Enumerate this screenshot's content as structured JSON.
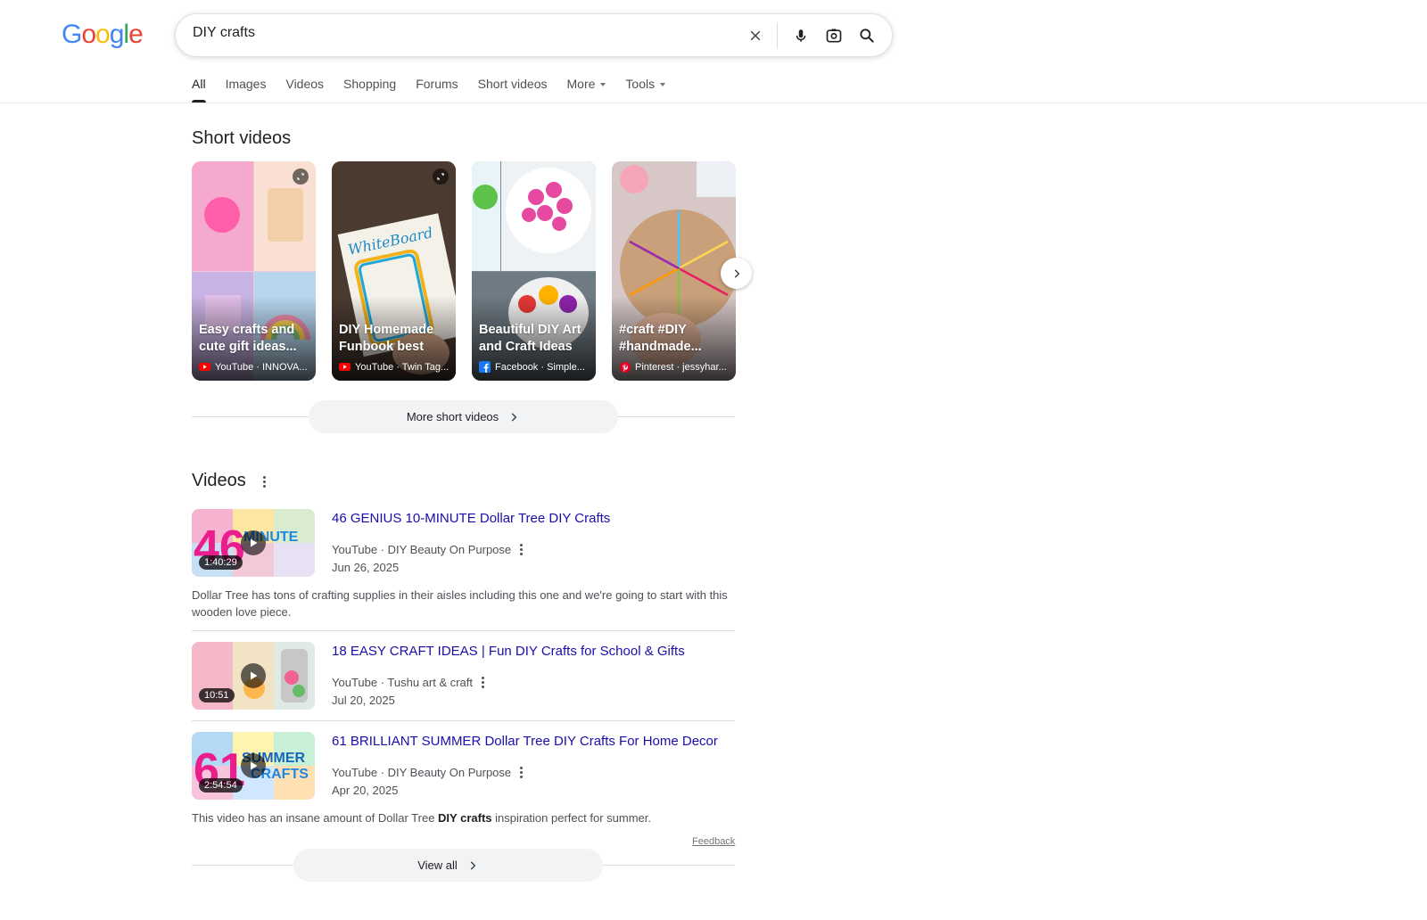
{
  "logo": {
    "letters": [
      "G",
      "o",
      "o",
      "g",
      "l",
      "e"
    ],
    "colors": [
      "#4285F4",
      "#EA4335",
      "#FBBC05",
      "#4285F4",
      "#34A853",
      "#EA4335"
    ]
  },
  "search": {
    "query": "DIY crafts"
  },
  "tabs": [
    "All",
    "Images",
    "Videos",
    "Shopping",
    "Forums",
    "Short videos",
    "More",
    "Tools"
  ],
  "short_videos": {
    "title": "Short videos",
    "cards": [
      {
        "title": "Easy crafts and cute gift ideas...",
        "source": "YouTube · INNOVA...",
        "source_icon": "youtube-icon",
        "bg": "#e8a3c4"
      },
      {
        "title": "DIY Homemade Funbook best ou...",
        "source": "YouTube · Twin Tag...",
        "source_icon": "youtube-icon",
        "bg": "#6b5a4c"
      },
      {
        "title": "Beautiful DIY Art and Craft Ideas a...",
        "source": "Facebook · Simple...",
        "source_icon": "facebook-icon",
        "bg": "#c7d9e4"
      },
      {
        "title": "#craft #DIY #handmade...",
        "source": "Pinterest · jessyhar...",
        "source_icon": "pinterest-icon",
        "bg": "#d9b9a1"
      }
    ],
    "more_label": "More short videos"
  },
  "videos": {
    "title": "Videos",
    "items": [
      {
        "title": "46 GENIUS 10-MINUTE Dollar Tree DIY Crafts",
        "meta": "YouTube · DIY Beauty On Purpose",
        "date": "Jun 26, 2025",
        "duration": "1:40:29",
        "description": "Dollar Tree has tons of crafting supplies in their aisles including this one and we're going to start with this wooden love piece.",
        "bg": "#f0c2d8"
      },
      {
        "title": "18 EASY CRAFT IDEAS | Fun DIY Crafts for School & Gifts",
        "meta": "YouTube · Tushu art & craft",
        "date": "Jul 20, 2025",
        "duration": "10:51",
        "description": "",
        "bg": "#e9d5c2"
      },
      {
        "title": "61 BRILLIANT SUMMER Dollar Tree DIY Crafts For Home Decor",
        "meta": "YouTube · DIY Beauty On Purpose",
        "date": "Apr 20, 2025",
        "duration": "2:54:54",
        "description_pre": "This video has an insane amount of Dollar Tree ",
        "description_bold": "DIY crafts",
        "description_post": " inspiration perfect for summer.",
        "bg": "#cfe3f5"
      }
    ],
    "feedback": "Feedback",
    "view_all": "View all"
  }
}
